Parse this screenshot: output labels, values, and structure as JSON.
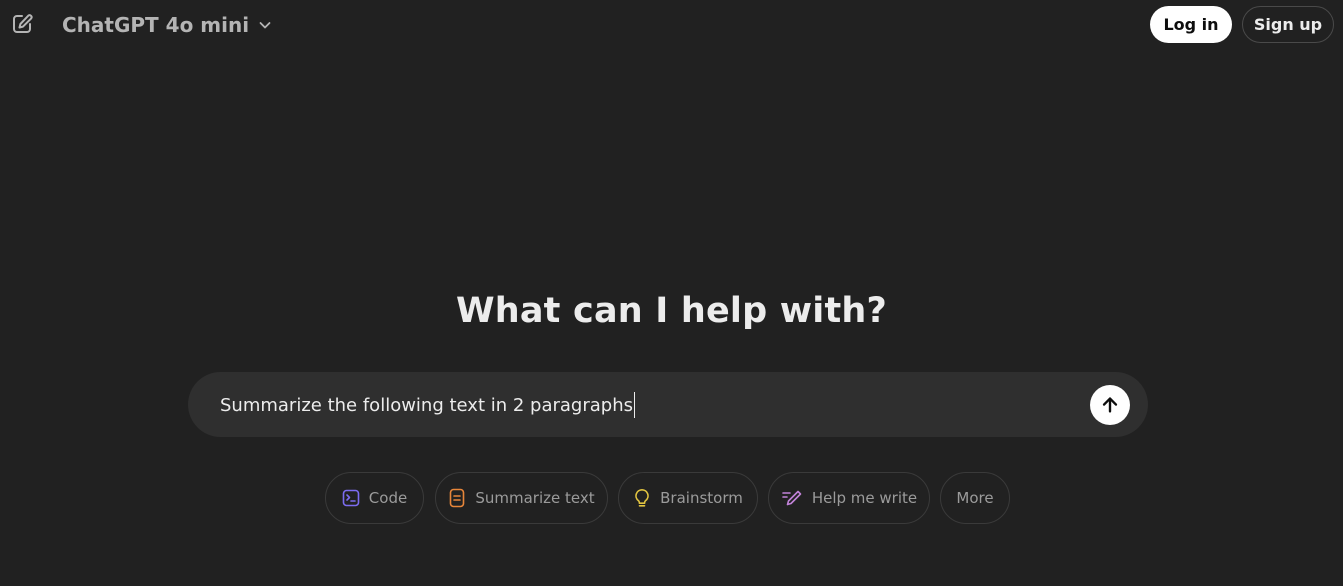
{
  "header": {
    "model_name": "ChatGPT 4o mini",
    "login_label": "Log in",
    "signup_label": "Sign up",
    "icons": {
      "new_chat": "edit-pencil-icon",
      "model_dropdown": "chevron-down-icon"
    }
  },
  "main": {
    "headline": "What can I help with?",
    "composer": {
      "value": "Summarize the following text in 2 paragraphs",
      "send_icon": "arrow-up-icon"
    },
    "suggestions": [
      {
        "label": "Code",
        "icon": "code-terminal-icon",
        "icon_color": "#7c6cf0"
      },
      {
        "label": "Summarize text",
        "icon": "document-icon",
        "icon_color": "#e8863a"
      },
      {
        "label": "Brainstorm",
        "icon": "lightbulb-icon",
        "icon_color": "#e2c541"
      },
      {
        "label": "Help me write",
        "icon": "pen-write-icon",
        "icon_color": "#c283d9"
      },
      {
        "label": "More",
        "icon": "",
        "icon_color": ""
      }
    ]
  },
  "colors": {
    "background": "#212121",
    "composer_bg": "#2f2f2f",
    "text_primary": "#ececec",
    "text_secondary": "#9b9b9b"
  }
}
